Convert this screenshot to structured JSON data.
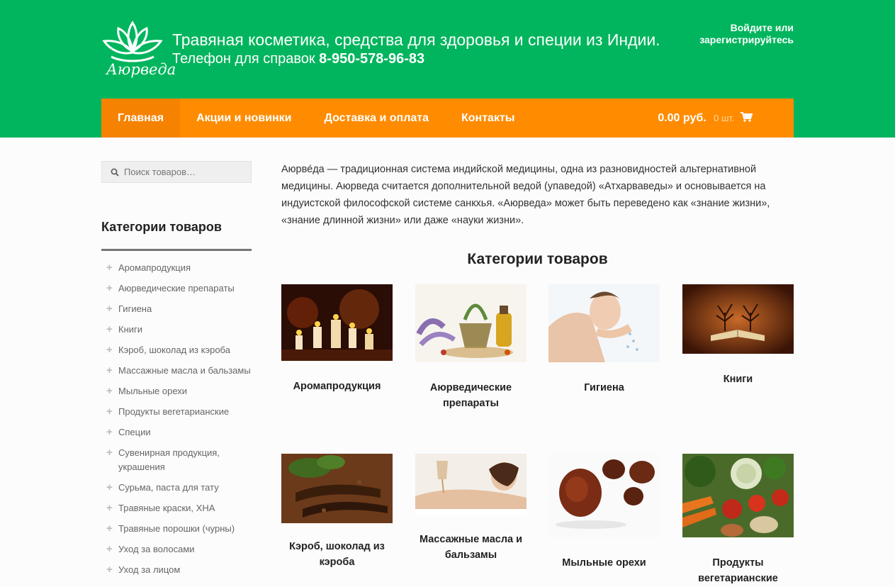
{
  "header": {
    "logo_text": "Аюрведа",
    "tagline": "Травяная косметика, средства для здоровья и специи из Индии.",
    "phone_label": "Телефон для справок",
    "phone": "8-950-578-96-83",
    "login_line1": "Войдите или",
    "login_line2": "зарегистрируйтесь"
  },
  "nav": {
    "items": [
      "Главная",
      "Акции и новинки",
      "Доставка и оплата",
      "Контакты"
    ],
    "cart_total": "0.00 руб.",
    "cart_count": "0 шт."
  },
  "sidebar": {
    "search_placeholder": "Поиск товаров…",
    "title": "Категории товаров",
    "categories": [
      "Аромапродукция",
      "Аюрведические препараты",
      "Гигиена",
      "Книги",
      "Кэроб, шоколад из кэроба",
      "Массажные масла и бальзамы",
      "Мыльные орехи",
      "Продукты вегетарианские",
      "Специи",
      "Сувенирная продукция, украшения",
      "Сурьма, паста для тату",
      "Травяные краски, ХНА",
      "Травяные порошки (чурны)",
      "Уход за волосами",
      "Уход за лицом"
    ]
  },
  "main": {
    "intro": "Аюрве́да — традиционная система индийской медицины, одна из разновидностей альтернативной медицины. Аюрведа считается дополнительной ведой (упаведой) «Атхарваведы» и основывается на индуистской философской системе санкхья. «Аюрведа» может быть переведено как «знание жизни», «знание длинной жизни» или даже «науки жизни».",
    "title": "Категории товаров",
    "cards": [
      "Аромапродукция",
      "Аюрведические препараты",
      "Гигиена",
      "Книги",
      "Кэроб, шоколад из кэроба",
      "Массажные масла и бальзамы",
      "Мыльные орехи",
      "Продукты вегетарианские"
    ]
  },
  "colors": {
    "header_bg": "#00b55d",
    "nav_bg": "#ff8c00"
  }
}
